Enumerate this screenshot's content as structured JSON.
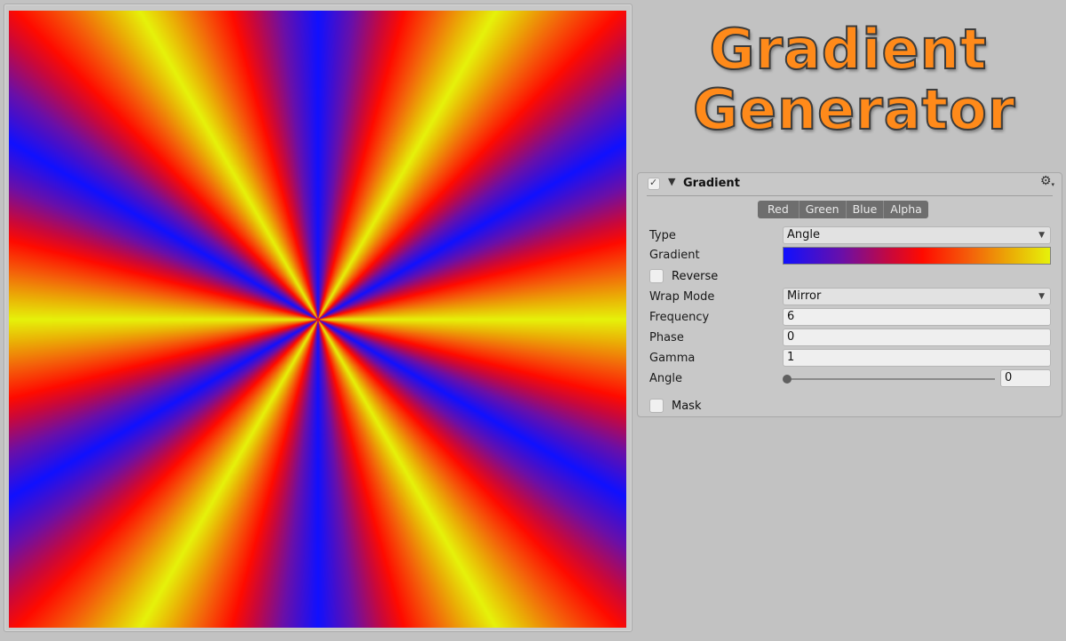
{
  "logo": {
    "line1": "Gradient",
    "line2": "Generator"
  },
  "preview": {
    "type": "Angle",
    "frequency": 6,
    "wrap_mode": "Mirror",
    "phase": 0,
    "angle_deg": 0,
    "gradient_stops": [
      {
        "pos": 0.0,
        "color": "#1010ff"
      },
      {
        "pos": 0.22,
        "color": "#6a0fa8"
      },
      {
        "pos": 0.4,
        "color": "#c8083c"
      },
      {
        "pos": 0.52,
        "color": "#ff0a00"
      },
      {
        "pos": 0.7,
        "color": "#f4600a"
      },
      {
        "pos": 0.86,
        "color": "#eab006"
      },
      {
        "pos": 1.0,
        "color": "#e6f20a"
      }
    ]
  },
  "panel": {
    "title": "Gradient",
    "enabled_check": "✓",
    "foldout_arrow": "▼",
    "gear_icon": "⚙",
    "gear_caret": "▾",
    "channel_tabs": [
      "Red",
      "Green",
      "Blue",
      "Alpha"
    ],
    "dropdown_arrow": "▼",
    "fields": {
      "type_label": "Type",
      "type_value": "Angle",
      "gradient_label": "Gradient",
      "reverse_label": "Reverse",
      "wrap_label": "Wrap Mode",
      "wrap_value": "Mirror",
      "frequency_label": "Frequency",
      "frequency_value": "6",
      "phase_label": "Phase",
      "phase_value": "0",
      "gamma_label": "Gamma",
      "gamma_value": "1",
      "angle_label": "Angle",
      "angle_value": "0",
      "angle_slider_fraction": 0,
      "mask_label": "Mask"
    }
  }
}
